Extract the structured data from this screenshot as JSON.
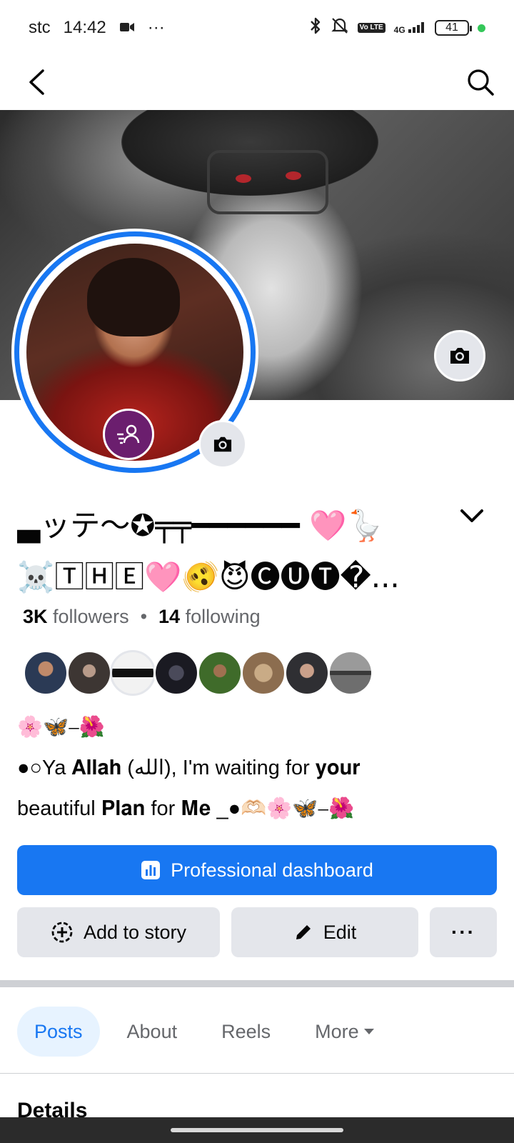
{
  "status_bar": {
    "carrier": "stc",
    "time": "14:42",
    "more": "···",
    "network": "4G",
    "volte": "Vo LTE",
    "battery": "41"
  },
  "top_nav": {
    "back_icon": "chevron-left-icon",
    "search_icon": "search-icon"
  },
  "profile": {
    "name_line_1": "▃ッテ〜✪╤╤━━━━━━ 🩷🪿",
    "name_line_2": "☠️🅃🄷🄴🩷🫨😈🅒🅤🅣�...",
    "followers_count": "3K",
    "followers_label": "followers",
    "separator": "•",
    "following_count": "14",
    "following_label": "following",
    "bio_line_1": "🌸🦋⎯🌺",
    "bio_line_2": "●○Ya 𝐀𝐥𝐥𝐚𝐡 (الله), I'm waiting for 𝐲𝐨𝐮𝐫",
    "bio_line_3": "beautiful 𝐏𝐥𝐚𝐧 for 𝐌𝐞 _●🫶🏻🌸🦋⎯🌺"
  },
  "buttons": {
    "professional_dashboard": "Professional dashboard",
    "add_to_story": "Add to story",
    "edit": "Edit",
    "more": "···"
  },
  "tabs": [
    {
      "label": "Posts",
      "active": true
    },
    {
      "label": "About",
      "active": false
    },
    {
      "label": "Reels",
      "active": false
    },
    {
      "label": "More",
      "active": false
    }
  ],
  "details_title": "Details",
  "colors": {
    "accent": "#1877f2",
    "avatar_ring": "#1877f2",
    "secondary_button": "#e4e6eb",
    "active_tab_bg": "#e7f3ff",
    "badge": "#6b1e6e"
  },
  "follower_avatar_colors": [
    "#2b3a55",
    "#3d3633",
    "#f2f2f2",
    "#1a1a22",
    "#3f6b2a",
    "#8c6d4f",
    "#2f2f33",
    "#6e6e6e"
  ]
}
